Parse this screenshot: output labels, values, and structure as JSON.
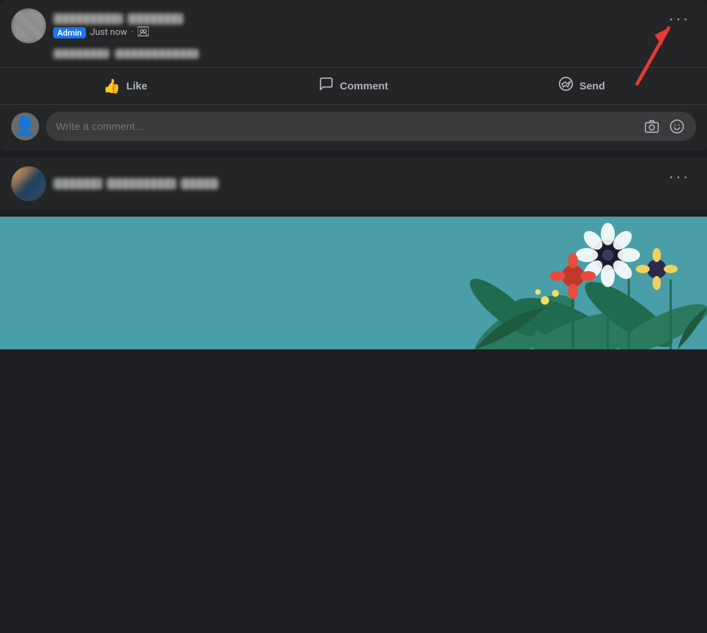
{
  "post1": {
    "admin_badge": "Admin",
    "time": "Just now",
    "privacy_icon": "🪟",
    "more_button_label": "···",
    "like_label": "Like",
    "comment_label": "Comment",
    "send_label": "Send",
    "comment_placeholder": "Write a comment..."
  },
  "post2": {
    "more_button_label": "···"
  },
  "arrow": {
    "pointing_to": "more-options-button"
  }
}
